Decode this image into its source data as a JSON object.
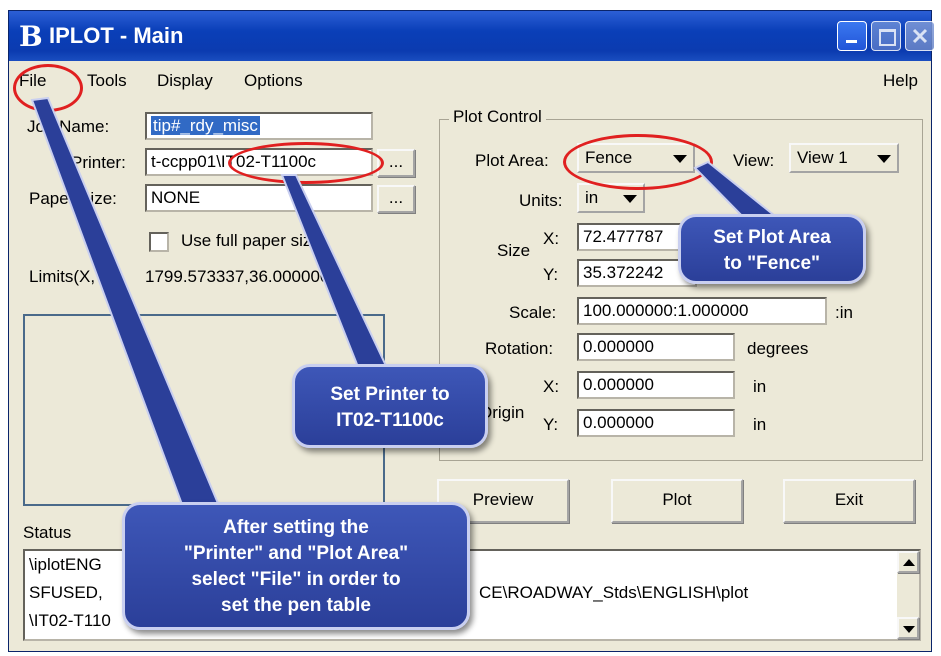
{
  "window": {
    "title": "IPLOT - Main",
    "app_icon": "bentley-b-icon"
  },
  "menu": {
    "file": "File",
    "tools": "Tools",
    "display": "Display",
    "options": "Options",
    "help": "Help"
  },
  "form": {
    "job_name_label": "Job Name:",
    "job_name_value": "tip#_rdy_misc",
    "printer_label": "Printer:",
    "printer_value": "t-ccpp01\\IT02-T1100c",
    "paper_size_label": "Paper Size:",
    "paper_size_value": "NONE",
    "browse": "...",
    "use_full_paper_label": "Use full paper size",
    "limits_label": "Limits(X,Y):",
    "limits_value": "1799.573337,36.000000"
  },
  "plot_control": {
    "title": "Plot Control",
    "plot_area_label": "Plot Area:",
    "plot_area_value": "Fence",
    "view_label": "View:",
    "view_value": "View 1",
    "units_label": "Units:",
    "units_value": "in",
    "size_label": "Size",
    "x_label": "X:",
    "y_label": "Y:",
    "size_x": "72.477787",
    "size_y": "35.372242",
    "scale_label": "Scale:",
    "scale_value": "100.000000:1.000000",
    "scale_unit": ":in",
    "rotation_label": "Rotation:",
    "rotation_value": "0.000000",
    "rotation_unit": "degrees",
    "origin_label": "Origin",
    "origin_x": "0.000000",
    "origin_y": "0.000000",
    "origin_unit": "in"
  },
  "buttons": {
    "preview": "Preview",
    "plot": "Plot",
    "exit": "Exit"
  },
  "status": {
    "label": "Status",
    "lines": [
      "\\iplotENG",
      "SFUSED,",
      "\\IT02-T110"
    ],
    "line2_tail": "CE\\ROADWAY_Stds\\ENGLISH\\plot"
  },
  "callouts": {
    "plot_area": [
      "Set Plot Area",
      "to \"Fence\""
    ],
    "printer": [
      "Set Printer to",
      "IT02-T1100c"
    ],
    "file": [
      "After setting the",
      "\"Printer\" and \"Plot Area\"",
      "select \"File\" in order to",
      "set the pen table"
    ]
  },
  "colors": {
    "titlebar": "#0a3fb8",
    "callout": "#2b3f99",
    "highlight_circle": "#e02020",
    "selection": "#316ac5"
  }
}
